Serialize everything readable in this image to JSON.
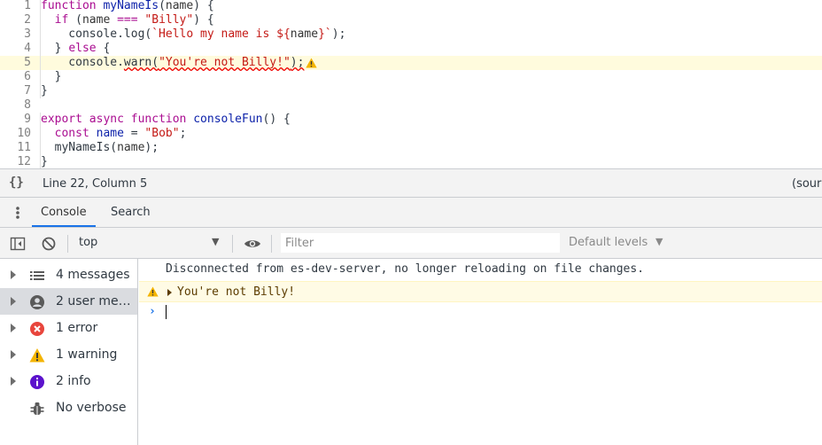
{
  "editor": {
    "lines": [
      {
        "num": "1",
        "tokens": [
          [
            "kw",
            "function"
          ],
          [
            "ident",
            " "
          ],
          [
            "def",
            "myNameIs"
          ],
          [
            "ident",
            "("
          ],
          [
            "var",
            "name"
          ],
          [
            "ident",
            ") {"
          ]
        ]
      },
      {
        "num": "2",
        "tokens": [
          [
            "ident",
            "  "
          ],
          [
            "kw",
            "if"
          ],
          [
            "ident",
            " ("
          ],
          [
            "var",
            "name"
          ],
          [
            "ident",
            " "
          ],
          [
            "kw",
            "==="
          ],
          [
            "ident",
            " "
          ],
          [
            "str",
            "\"Billy\""
          ],
          [
            "ident",
            ") {"
          ]
        ]
      },
      {
        "num": "3",
        "tokens": [
          [
            "ident",
            "    console.log("
          ],
          [
            "str",
            "`Hello my name is ${"
          ],
          [
            "var",
            "name"
          ],
          [
            "str",
            "}`"
          ],
          [
            "ident",
            ");"
          ]
        ]
      },
      {
        "num": "4",
        "tokens": [
          [
            "ident",
            "  } "
          ],
          [
            "kw",
            "else"
          ],
          [
            "ident",
            " {"
          ]
        ]
      },
      {
        "num": "5",
        "tokens": [
          [
            "ident",
            "    console."
          ],
          [
            "sq",
            "warn("
          ],
          [
            "sqstr",
            "\"You're not Billy!\""
          ],
          [
            "sq",
            ");"
          ]
        ],
        "warning": true
      },
      {
        "num": "6",
        "tokens": [
          [
            "ident",
            "  }"
          ]
        ]
      },
      {
        "num": "7",
        "tokens": [
          [
            "ident",
            "}"
          ]
        ]
      },
      {
        "num": "8",
        "tokens": []
      },
      {
        "num": "9",
        "tokens": [
          [
            "kw",
            "export"
          ],
          [
            "ident",
            " "
          ],
          [
            "kw",
            "async"
          ],
          [
            "ident",
            " "
          ],
          [
            "kw",
            "function"
          ],
          [
            "ident",
            " "
          ],
          [
            "def",
            "consoleFun"
          ],
          [
            "ident",
            "() {"
          ]
        ]
      },
      {
        "num": "10",
        "tokens": [
          [
            "ident",
            "  "
          ],
          [
            "kw",
            "const"
          ],
          [
            "ident",
            " "
          ],
          [
            "def",
            "name"
          ],
          [
            "ident",
            " = "
          ],
          [
            "str",
            "\"Bob\""
          ],
          [
            "ident",
            ";"
          ]
        ]
      },
      {
        "num": "11",
        "tokens": [
          [
            "ident",
            "  myNameIs("
          ],
          [
            "var",
            "name"
          ],
          [
            "ident",
            ");"
          ]
        ]
      },
      {
        "num": "12",
        "tokens": [
          [
            "ident",
            "}"
          ]
        ]
      }
    ]
  },
  "statusbar": {
    "braces": "{}",
    "position": "Line 22, Column 5",
    "source": "(sour"
  },
  "drawer": {
    "tabs": [
      {
        "label": "Console",
        "active": true
      },
      {
        "label": "Search",
        "active": false
      }
    ]
  },
  "toolbar": {
    "context": "top",
    "filter_placeholder": "Filter",
    "levels": "Default levels"
  },
  "sidebar": {
    "items": [
      {
        "label": "4 messages",
        "icon": "list-icon",
        "arrow": true,
        "selected": false
      },
      {
        "label": "2 user mes…",
        "icon": "user-icon",
        "arrow": true,
        "selected": true
      },
      {
        "label": "1 error",
        "icon": "error-icon",
        "arrow": true,
        "selected": false
      },
      {
        "label": "1 warning",
        "icon": "warning-icon",
        "arrow": true,
        "selected": false
      },
      {
        "label": "2 info",
        "icon": "info-icon",
        "arrow": true,
        "selected": false
      },
      {
        "label": "No verbose",
        "icon": "bug-icon",
        "arrow": false,
        "selected": false
      }
    ]
  },
  "console": {
    "info_message": "Disconnected from es-dev-server, no longer reloading on file changes.",
    "warning_message": "You're not Billy!",
    "prompt": "›"
  },
  "colors": {
    "accent": "#1a73e8",
    "warning_bg": "#fffbe5",
    "error_red": "#e8453c",
    "warning_yellow": "#f4b400",
    "info_purple": "#5b12cc"
  }
}
